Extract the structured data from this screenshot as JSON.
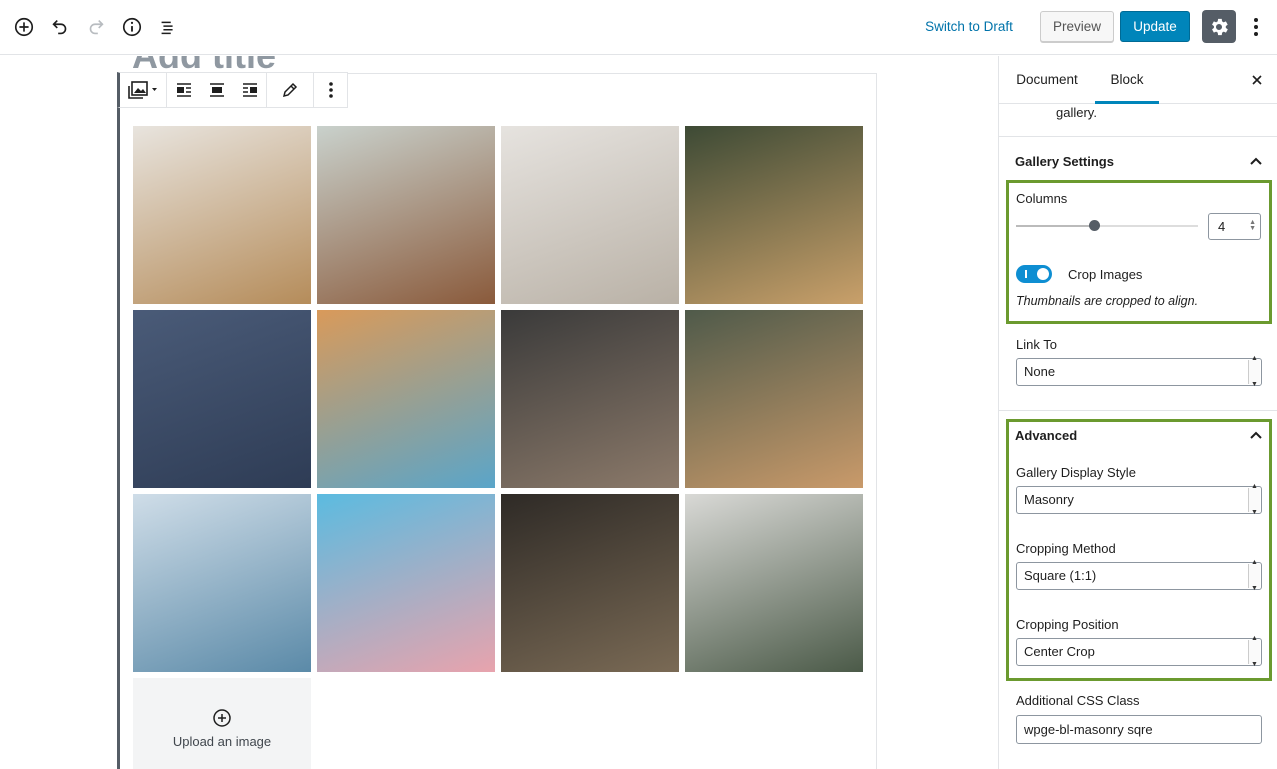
{
  "topbar": {
    "switch_to_draft": "Switch to Draft",
    "preview": "Preview",
    "update": "Update"
  },
  "editor": {
    "title_placeholder": "Add title",
    "upload_label": "Upload an image",
    "gallery_images": [
      {
        "name": "dining-room-photo",
        "colors": [
          "#e8e4de",
          "#b58c5a"
        ]
      },
      {
        "name": "wooden-table-photo",
        "colors": [
          "#c9d1cc",
          "#8a5a3b"
        ]
      },
      {
        "name": "woman-beach-photo",
        "colors": [
          "#e6e3df",
          "#b9b1a6"
        ]
      },
      {
        "name": "christmas-gift-photo",
        "colors": [
          "#3d4a35",
          "#c9a06a"
        ]
      },
      {
        "name": "airplane-photo",
        "colors": [
          "#4a5b78",
          "#2e3c55"
        ]
      },
      {
        "name": "beach-aerial-photo",
        "colors": [
          "#d99a5a",
          "#5aa5c9"
        ]
      },
      {
        "name": "city-street-photo",
        "colors": [
          "#3a3a3a",
          "#8c7a6a"
        ]
      },
      {
        "name": "ornament-photo",
        "colors": [
          "#4f5a4a",
          "#c99a6a"
        ]
      },
      {
        "name": "bicycle-beach-photo",
        "colors": [
          "#cfdde8",
          "#5b8aa8"
        ]
      },
      {
        "name": "woman-denim-photo",
        "colors": [
          "#5bbbe0",
          "#e8a3ad"
        ]
      },
      {
        "name": "living-room-photo",
        "colors": [
          "#2e2a26",
          "#7a6a55"
        ]
      },
      {
        "name": "office-interior-photo",
        "colors": [
          "#d9d9d6",
          "#4b5a48"
        ]
      }
    ]
  },
  "sidebar": {
    "tabs": [
      "Document",
      "Block"
    ],
    "description_tail": "gallery.",
    "gallery_settings": {
      "title": "Gallery Settings",
      "columns_label": "Columns",
      "columns_value": "4",
      "columns_fraction": 0.43,
      "crop_label": "Crop Images",
      "crop_help": "Thumbnails are cropped to align.",
      "link_to_label": "Link To",
      "link_to_value": "None"
    },
    "advanced": {
      "title": "Advanced",
      "display_style_label": "Gallery Display Style",
      "display_style_value": "Masonry",
      "cropping_method_label": "Cropping Method",
      "cropping_method_value": "Square (1:1)",
      "cropping_position_label": "Cropping Position",
      "cropping_position_value": "Center Crop",
      "css_class_label": "Additional CSS Class",
      "css_class_value": "wpge-bl-masonry sqre"
    },
    "colors": {
      "highlight": "#6b9a2f",
      "accent": "#0085ba"
    }
  }
}
